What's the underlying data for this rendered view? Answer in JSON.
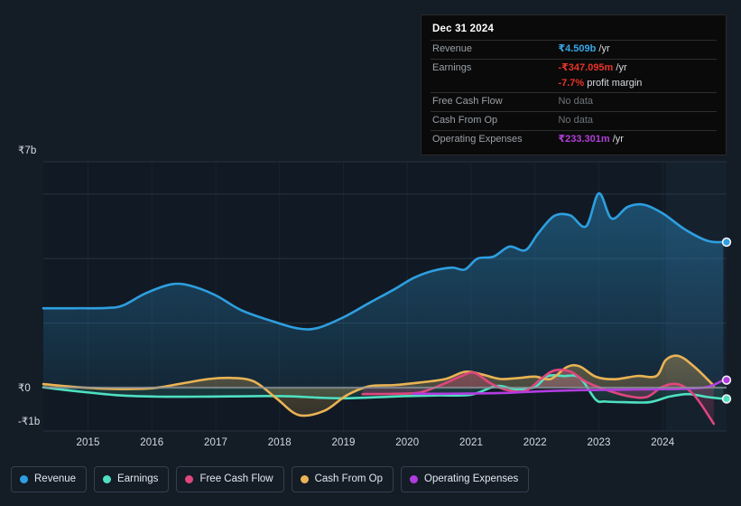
{
  "tooltip": {
    "date": "Dec 31 2024",
    "rows": [
      {
        "label": "Revenue",
        "value": "₹4.509b",
        "unit": " /yr",
        "style": "v-rev"
      },
      {
        "label": "Earnings",
        "value": "-₹347.095m",
        "unit": " /yr",
        "style": "v-earn"
      },
      {
        "label": "",
        "value": "-7.7%",
        "unit": " profit margin",
        "style": "v-earn"
      },
      {
        "label": "Free Cash Flow",
        "value": "No data",
        "unit": "",
        "style": "tt-nodata"
      },
      {
        "label": "Cash From Op",
        "value": "No data",
        "unit": "",
        "style": "tt-nodata"
      },
      {
        "label": "Operating Expenses",
        "value": "₹233.301m",
        "unit": " /yr",
        "style": "v-opex"
      }
    ]
  },
  "legend": [
    {
      "label": "Revenue",
      "color": "#2e9fe0"
    },
    {
      "label": "Earnings",
      "color": "#4ee0c1"
    },
    {
      "label": "Free Cash Flow",
      "color": "#e0467e"
    },
    {
      "label": "Cash From Op",
      "color": "#eab354"
    },
    {
      "label": "Operating Expenses",
      "color": "#b23ce0"
    }
  ],
  "colors": {
    "background": "#141c26",
    "plot_background": "#111a24",
    "forecast_band": "#16212e",
    "gridline": "#2b3846",
    "zero_line": "#8d949c",
    "revenue": "#2e9fe0",
    "earnings": "#4ee0c1",
    "free_cash_flow": "#e0467e",
    "cash_from_op": "#eab354",
    "operating_expenses": "#b23ce0"
  },
  "chart_data": {
    "type": "line",
    "title": "",
    "xlabel": "",
    "ylabel": "",
    "grid": true,
    "legend_position": "bottom",
    "currency": "₹",
    "units": "billions",
    "ylim": [
      -1.3,
      7.3
    ],
    "ytick_labels": [
      "₹7b",
      "₹0",
      "-₹1b"
    ],
    "ytick_values": [
      7,
      0,
      -1
    ],
    "xtick_labels": [
      "2015",
      "2016",
      "2017",
      "2018",
      "2019",
      "2020",
      "2021",
      "2022",
      "2023",
      "2024"
    ],
    "xlim": [
      2014.3,
      2025.0
    ],
    "forecast_starts": 2024.05,
    "series": [
      {
        "name": "Revenue",
        "color": "#2e9fe0",
        "filled": true,
        "x": [
          2014.3,
          2014.8,
          2015.3,
          2015.55,
          2015.9,
          2016.3,
          2016.6,
          2017.0,
          2017.4,
          2017.9,
          2018.3,
          2018.6,
          2019.0,
          2019.4,
          2019.8,
          2020.1,
          2020.4,
          2020.7,
          2020.9,
          2021.1,
          2021.35,
          2021.6,
          2021.85,
          2022.05,
          2022.3,
          2022.55,
          2022.8,
          2023.0,
          2023.2,
          2023.45,
          2023.7,
          2024.0,
          2024.35,
          2024.7,
          2024.95
        ],
        "y": [
          2.46,
          2.46,
          2.47,
          2.55,
          2.92,
          3.2,
          3.16,
          2.86,
          2.4,
          2.05,
          1.83,
          1.85,
          2.18,
          2.62,
          3.05,
          3.4,
          3.62,
          3.72,
          3.66,
          4.0,
          4.06,
          4.37,
          4.26,
          4.78,
          5.32,
          5.34,
          5.0,
          6.02,
          5.24,
          5.6,
          5.67,
          5.4,
          4.9,
          4.55,
          4.509
        ]
      },
      {
        "name": "Earnings",
        "color": "#4ee0c1",
        "filled": true,
        "x": [
          2014.3,
          2014.9,
          2015.5,
          2016.1,
          2016.7,
          2017.3,
          2017.8,
          2018.2,
          2018.6,
          2019.0,
          2019.5,
          2020.0,
          2020.5,
          2021.0,
          2021.4,
          2021.7,
          2022.0,
          2022.2,
          2022.45,
          2022.7,
          2022.95,
          2023.1,
          2023.4,
          2023.8,
          2024.1,
          2024.4,
          2024.7,
          2024.95
        ],
        "y": [
          0.01,
          -0.13,
          -0.24,
          -0.28,
          -0.28,
          -0.27,
          -0.26,
          -0.27,
          -0.31,
          -0.33,
          -0.3,
          -0.26,
          -0.24,
          -0.22,
          0.05,
          -0.05,
          0.02,
          0.36,
          0.36,
          0.31,
          -0.37,
          -0.43,
          -0.45,
          -0.45,
          -0.28,
          -0.2,
          -0.29,
          -0.347
        ]
      },
      {
        "name": "Free Cash Flow",
        "color": "#e0467e",
        "filled": true,
        "x": [
          2019.3,
          2019.8,
          2020.2,
          2020.55,
          2020.85,
          2021.05,
          2021.3,
          2021.55,
          2021.85,
          2022.1,
          2022.3,
          2022.55,
          2022.8,
          2023.1,
          2023.45,
          2023.75,
          2024.0,
          2024.25,
          2024.5,
          2024.8
        ],
        "y": [
          -0.2,
          -0.19,
          -0.15,
          0.1,
          0.36,
          0.46,
          0.14,
          -0.07,
          -0.1,
          0.28,
          0.53,
          0.5,
          0.18,
          -0.06,
          -0.26,
          -0.29,
          0.03,
          0.1,
          -0.25,
          -1.12
        ]
      },
      {
        "name": "Cash From Op",
        "color": "#eab354",
        "filled": true,
        "x": [
          2014.3,
          2014.8,
          2015.4,
          2016.0,
          2016.5,
          2016.9,
          2017.25,
          2017.6,
          2017.95,
          2018.3,
          2018.7,
          2019.05,
          2019.4,
          2019.8,
          2020.2,
          2020.6,
          2020.9,
          2021.15,
          2021.45,
          2021.75,
          2022.0,
          2022.25,
          2022.5,
          2022.7,
          2022.95,
          2023.25,
          2023.6,
          2023.9,
          2024.05,
          2024.25,
          2024.5,
          2024.8
        ],
        "y": [
          0.11,
          0.02,
          -0.04,
          -0.02,
          0.14,
          0.27,
          0.3,
          0.19,
          -0.33,
          -0.85,
          -0.72,
          -0.24,
          0.04,
          0.08,
          0.16,
          0.27,
          0.49,
          0.42,
          0.27,
          0.3,
          0.34,
          0.27,
          0.64,
          0.66,
          0.34,
          0.26,
          0.36,
          0.36,
          0.86,
          0.98,
          0.64,
          0.06
        ]
      },
      {
        "name": "Operating Expenses",
        "color": "#b23ce0",
        "filled": false,
        "x": [
          2020.1,
          2020.6,
          2021.1,
          2021.6,
          2022.0,
          2022.3,
          2022.7,
          2023.1,
          2023.5,
          2023.9,
          2024.3,
          2024.7,
          2024.95
        ],
        "y": [
          -0.19,
          -0.19,
          -0.18,
          -0.16,
          -0.12,
          -0.1,
          -0.08,
          -0.07,
          -0.06,
          -0.05,
          -0.04,
          0.02,
          0.233
        ]
      }
    ],
    "endpoints": [
      {
        "name": "Revenue",
        "value": 4.509,
        "color": "#2e9fe0"
      },
      {
        "name": "Operating Expenses",
        "value": 0.233,
        "color": "#b23ce0"
      },
      {
        "name": "Earnings",
        "value": -0.347,
        "color": "#4ee0c1"
      }
    ]
  }
}
